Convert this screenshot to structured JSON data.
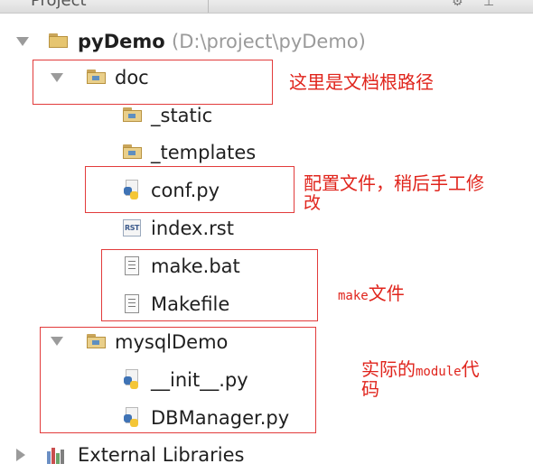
{
  "header": {
    "panel_title": "Project"
  },
  "tree": {
    "project": {
      "name": "pyDemo",
      "path": "(D:\\project\\pyDemo)"
    },
    "doc": {
      "name": "doc"
    },
    "static": {
      "name": "_static"
    },
    "templates": {
      "name": "_templates"
    },
    "conf": {
      "name": "conf.py"
    },
    "index": {
      "name": "index.rst",
      "icon_text": "RST"
    },
    "makebat": {
      "name": "make.bat"
    },
    "makefile": {
      "name": "Makefile"
    },
    "mysqldemo": {
      "name": "mysqlDemo"
    },
    "init": {
      "name": "__init__.py"
    },
    "dbmanager": {
      "name": "DBManager.py"
    },
    "extlibs": {
      "name": "External Libraries"
    }
  },
  "annotations": {
    "doc_note": "这里是文档根路径",
    "conf_note_line1": "配置文件，稍后手工修",
    "conf_note_line2": "改",
    "make_note_prefix": "make",
    "make_note_suffix": "文件",
    "module_note_line1_a": "实际的",
    "module_note_line1_b": "module",
    "module_note_line1_c": "代",
    "module_note_line2": "码"
  },
  "colors": {
    "annotation_red": "#e0241c",
    "path_gray": "#9a9a9a"
  }
}
